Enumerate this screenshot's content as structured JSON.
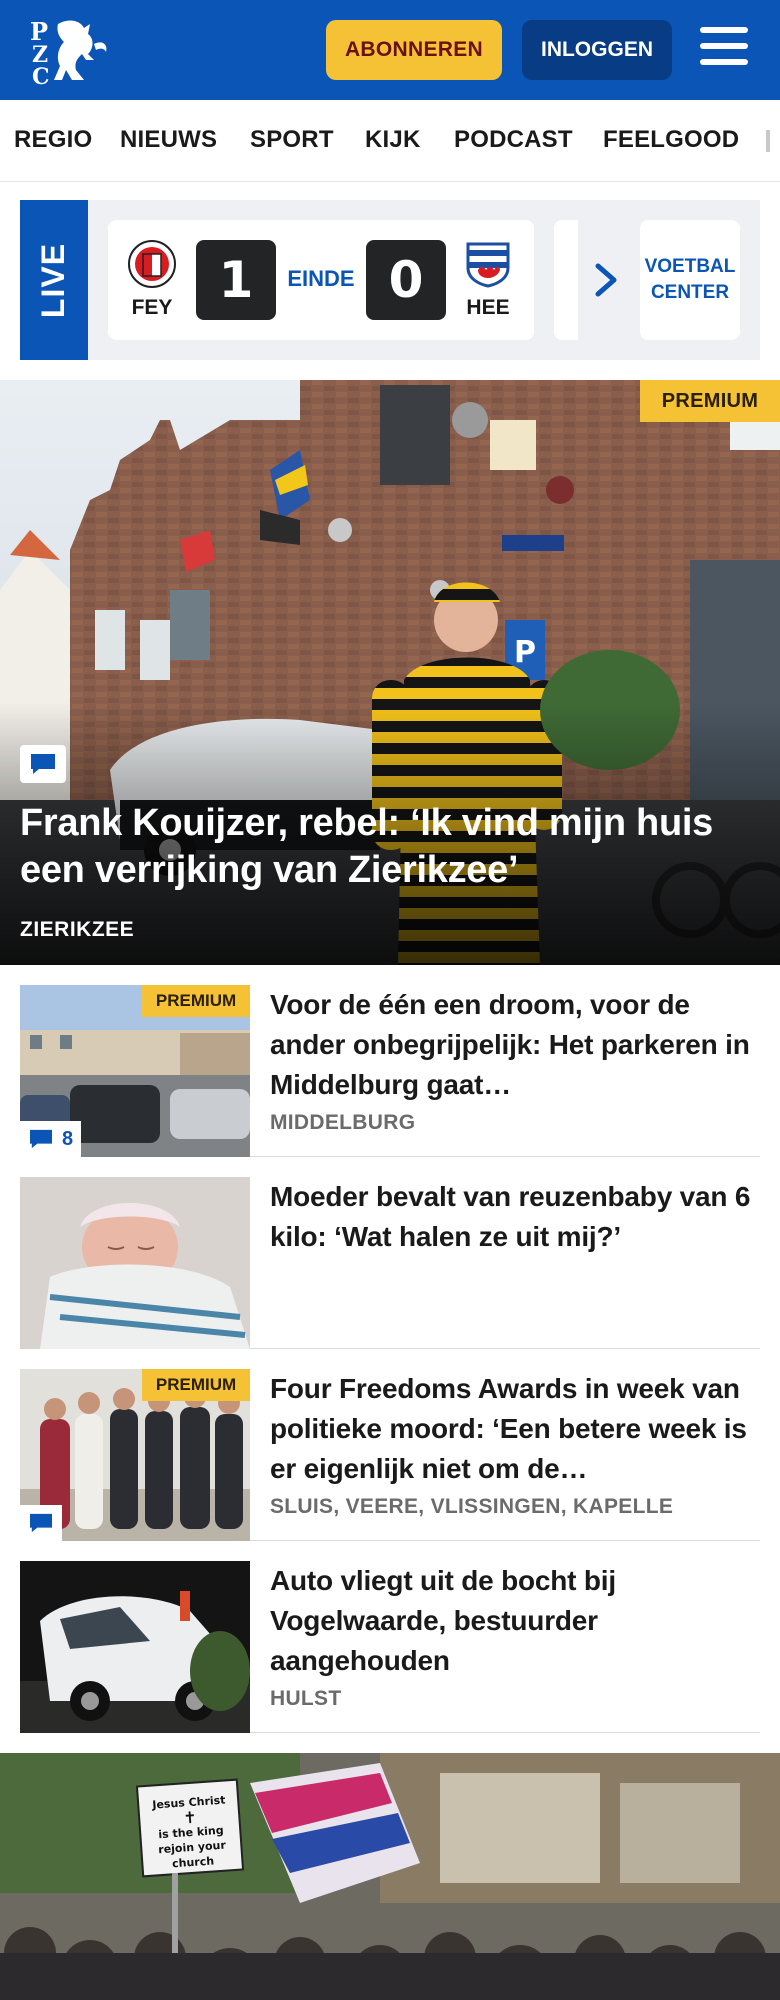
{
  "header": {
    "logo_text": "PZC",
    "subscribe_label": "ABONNEREN",
    "login_label": "INLOGGEN",
    "colors": {
      "brand": "#0a55b5",
      "accent": "#f5c235"
    }
  },
  "nav": {
    "items": [
      {
        "label": "REGIO"
      },
      {
        "label": "NIEUWS"
      },
      {
        "label": "SPORT"
      },
      {
        "label": "KIJK"
      },
      {
        "label": "PODCAST"
      },
      {
        "label": "FEELGOOD"
      }
    ]
  },
  "live": {
    "label": "LIVE",
    "match": {
      "home_code": "FEY",
      "home_score": "1",
      "status": "EINDE",
      "away_score": "0",
      "away_code": "HEE"
    },
    "center_line1": "VOETBAL",
    "center_line2": "CENTER"
  },
  "hero": {
    "badge": "PREMIUM",
    "title": "Frank Kouijzer, rebel: ‘Ik vind mijn huis een verrijking van Zierikzee’",
    "location": "ZIERIKZEE"
  },
  "articles": [
    {
      "badge": "PREMIUM",
      "comments": "8",
      "title": "Voor de één een droom, voor de ander onbegrijpelijk: Het parkeren in Middelburg gaat…",
      "location": "MIDDELBURG"
    },
    {
      "title": "Moeder bevalt van reuzenbaby van 6 kilo: ‘Wat halen ze uit mij?’"
    },
    {
      "badge": "PREMIUM",
      "title": "Four Freedoms Awards in week van politieke moord: ‘Een betere week is er eigenlijk niet om de…",
      "location": "SLUIS, VEERE, VLISSINGEN, KAPELLE"
    },
    {
      "title": "Auto vliegt uit de bocht bij Vogelwaarde, bestuurder aangehouden",
      "location": "HULST"
    }
  ],
  "bottom_photo": {
    "sign_line1": "Jesus Christ",
    "sign_line2": "is the king",
    "sign_line3": "rejoin your church"
  }
}
